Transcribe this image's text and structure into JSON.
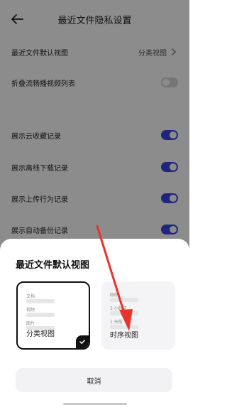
{
  "header": {
    "title": "最近文件隐私设置",
    "back_icon": "back-arrow-icon"
  },
  "settings": {
    "default_view": {
      "label": "最近文件默认视图",
      "value": "分类视图"
    },
    "toggles": [
      {
        "label": "折叠流畅播视频列表",
        "state": false
      },
      {
        "label": "展示云收藏记录",
        "state": true
      },
      {
        "label": "展示离线下载记录",
        "state": true
      },
      {
        "label": "展示上传行为记录",
        "state": true
      },
      {
        "label": "展示自动备份记录",
        "state": true
      }
    ]
  },
  "sheet": {
    "title": "最近文件默认视图",
    "options": [
      {
        "label": "分类视图",
        "selected": true,
        "preview": [
          "文档",
          "视频",
          "图片"
        ]
      },
      {
        "label": "时序视图",
        "selected": false,
        "preview": [
          "刚刚",
          "3 小时前",
          "1 天前"
        ]
      }
    ],
    "cancel_label": "取消"
  },
  "colors": {
    "accent": "#3b46e6",
    "toggle_off": "#d8d8d8",
    "annotation": "#e8352b"
  }
}
